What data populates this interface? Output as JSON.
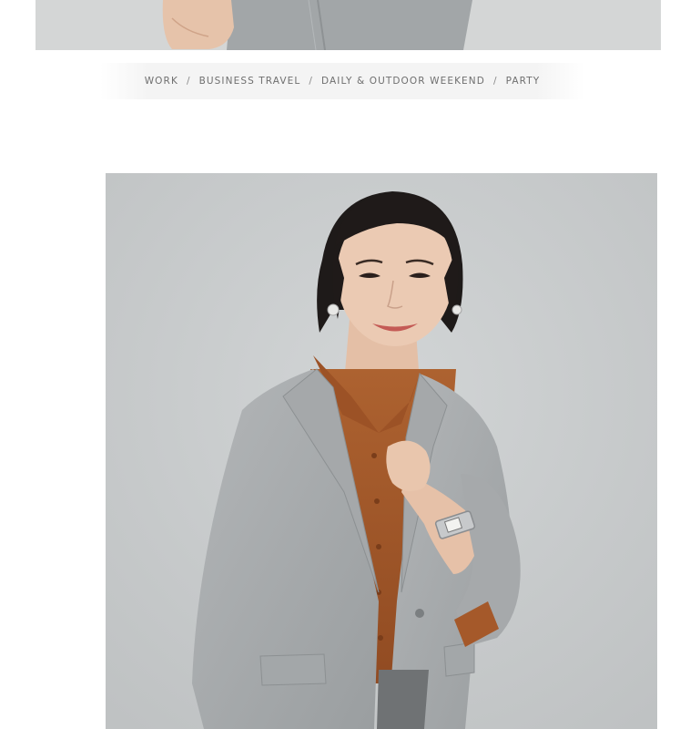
{
  "occasions": {
    "items": [
      "WORK",
      "BUSINESS TRAVEL",
      "DAILY & OUTDOOR WEEKEND",
      "PARTY"
    ],
    "separator": "/"
  },
  "colors": {
    "background": "#ffffff",
    "photo_backdrop": "#c9cccd",
    "blazer_gray": "#a9acae",
    "shirt_brown": "#a4582a",
    "occasion_text": "#6f6f6f"
  }
}
